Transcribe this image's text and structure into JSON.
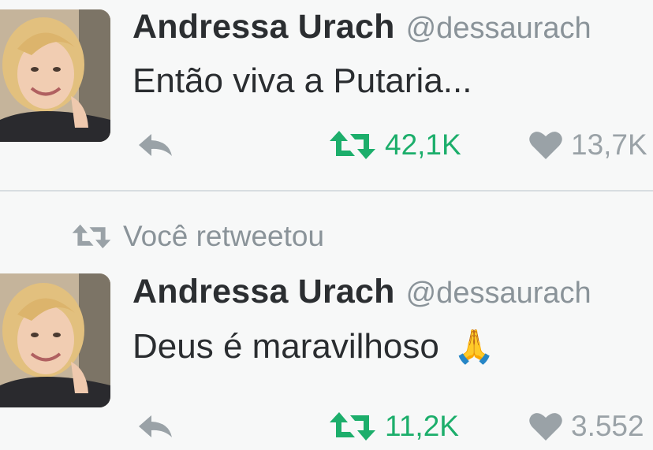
{
  "tweets": [
    {
      "author": {
        "name": "Andressa Urach",
        "handle": "@dessaurach"
      },
      "text": "Então viva a Putaria...",
      "retweet_count": "42,1K",
      "like_count": "13,7K",
      "icons": {
        "reply": "reply-icon",
        "retweet": "retweet-icon",
        "like": "heart-icon"
      }
    },
    {
      "retweet_context": "Você retweetou",
      "author": {
        "name": "Andressa Urach",
        "handle": "@dessaurach"
      },
      "text": "Deus é maravilhoso",
      "emoji": "🙏",
      "retweet_count": "11,2K",
      "like_count": "3.552",
      "icons": {
        "reply": "reply-icon",
        "retweet": "retweet-icon",
        "like": "heart-icon"
      }
    }
  ],
  "colors": {
    "retweet_green": "#1cae6b",
    "gray": "#8a9399",
    "background": "#f7f8f8"
  }
}
